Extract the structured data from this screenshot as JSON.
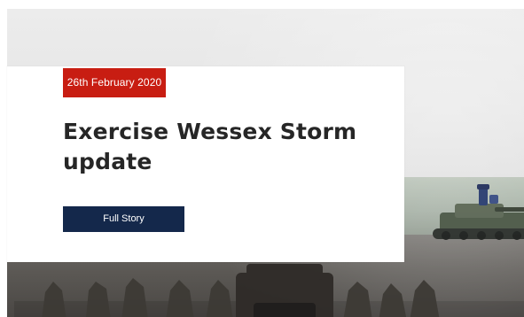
{
  "article": {
    "date": "26th February 2020",
    "title": "Exercise Wessex Storm update",
    "button_label": "Full Story"
  },
  "colors": {
    "date_badge_bg": "#c81d12",
    "button_bg": "#14284b",
    "text_dark": "#262626"
  }
}
